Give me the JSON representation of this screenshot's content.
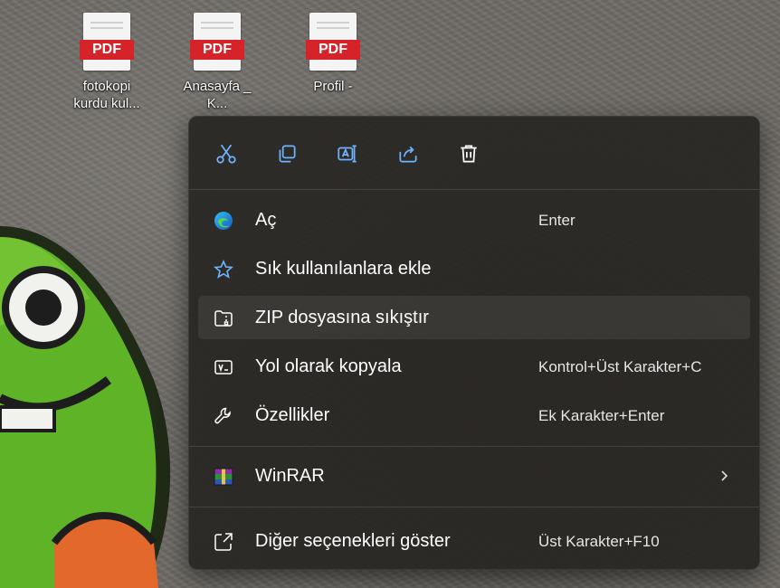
{
  "desktop": {
    "icons": [
      {
        "badge": "PDF",
        "label_line1": "fotokopi",
        "label_line2": "kurdu kul..."
      },
      {
        "badge": "PDF",
        "label_line1": "Anasayfa _",
        "label_line2": "K..."
      },
      {
        "badge": "PDF",
        "label_line1": "Profil -",
        "label_line2": ""
      }
    ]
  },
  "context_menu": {
    "quick_actions": [
      {
        "icon": "cut-icon"
      },
      {
        "icon": "copy-icon"
      },
      {
        "icon": "rename-icon"
      },
      {
        "icon": "share-icon"
      },
      {
        "icon": "delete-icon"
      }
    ],
    "items": [
      {
        "icon": "edge-icon",
        "label": "Aç",
        "shortcut": "Enter"
      },
      {
        "icon": "star-icon",
        "label": "Sık kullanılanlara ekle",
        "shortcut": ""
      },
      {
        "icon": "zip-folder-icon",
        "label": "ZIP dosyasına sıkıştır",
        "shortcut": "",
        "hovered": true
      },
      {
        "icon": "copy-path-icon",
        "label": "Yol olarak kopyala",
        "shortcut": "Kontrol+Üst Karakter+C"
      },
      {
        "icon": "wrench-icon",
        "label": "Özellikler",
        "shortcut": "Ek Karakter+Enter"
      },
      {
        "icon": "winrar-icon",
        "label": "WinRAR",
        "shortcut": "",
        "submenu": true
      },
      {
        "icon": "more-options-icon",
        "label": "Diğer seçenekleri göster",
        "shortcut": "Üst Karakter+F10"
      }
    ]
  },
  "colors": {
    "menu_bg": "#282622",
    "accent_icon": "#6fb3ff",
    "pdf_badge": "#d6232a"
  }
}
